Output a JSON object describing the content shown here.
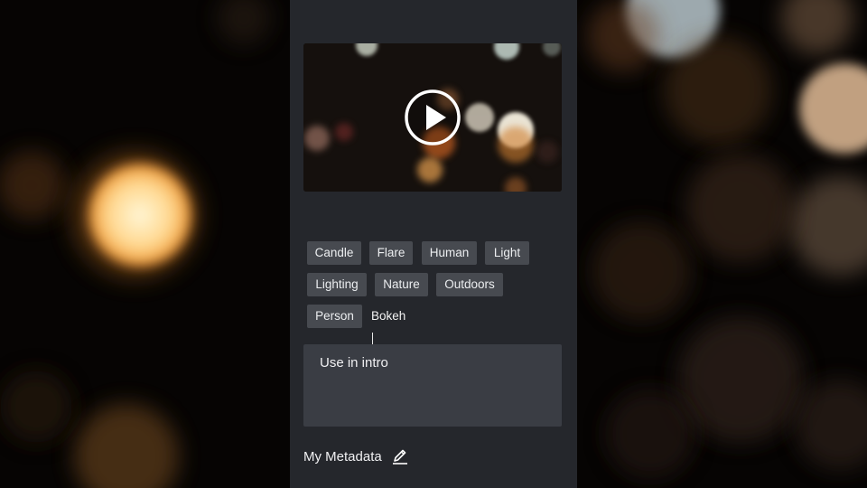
{
  "video": {
    "play_icon": "play-circle-icon"
  },
  "tags": {
    "items": [
      "Candle",
      "Flare",
      "Human",
      "Light",
      "Lighting",
      "Nature",
      "Outdoors",
      "Person"
    ],
    "input_value": "Bokeh"
  },
  "note": {
    "text": "Use in intro"
  },
  "metadata": {
    "label": "My Metadata",
    "edit_icon": "pencil-icon"
  },
  "colors": {
    "panel": "#25272c",
    "tag": "#474a50",
    "note_box": "#3a3d44",
    "text": "#f0f0f2"
  }
}
